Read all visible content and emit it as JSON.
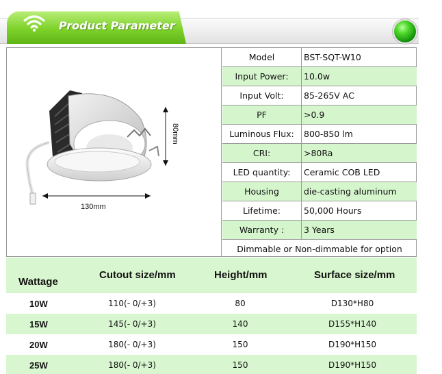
{
  "header": {
    "title": "Product Parameter"
  },
  "product_image": {
    "width_label": "130mm",
    "height_label": "80mm"
  },
  "specs": [
    {
      "label": "Model",
      "value": "BST-SQT-W10"
    },
    {
      "label": "Input Power:",
      "value": "10.0w"
    },
    {
      "label": "Input Volt:",
      "value": "85-265V AC"
    },
    {
      "label": "PF",
      "value": ">0.9"
    },
    {
      "label": "Luminous Flux:",
      "value": "800-850 lm"
    },
    {
      "label": "CRI:",
      "value": ">80Ra"
    },
    {
      "label": "LED quantity:",
      "value": "Ceramic COB LED"
    },
    {
      "label": "Housing",
      "value": "die-casting aluminum"
    },
    {
      "label": "Lifetime:",
      "value": "50,000 Hours"
    },
    {
      "label": "Warranty :",
      "value": "3 Years"
    }
  ],
  "spec_note": "Dimmable or Non-dimmable for option",
  "size_table": {
    "headers": [
      "Wattage",
      "Cutout size/mm",
      "Height/mm",
      "Surface size/mm"
    ],
    "rows": [
      [
        "10W",
        "110(- 0/+3)",
        "80",
        "D130*H80"
      ],
      [
        "15W",
        "145(- 0/+3)",
        "140",
        "D155*H140"
      ],
      [
        "20W",
        "180(- 0/+3)",
        "150",
        "D190*H150"
      ],
      [
        "25W",
        "180(- 0/+3)",
        "150",
        "D190*H150"
      ]
    ]
  },
  "colors": {
    "accent_green": "#7ed22a",
    "row_green": "#d5f5cd",
    "status_led": "#2fc41a"
  }
}
